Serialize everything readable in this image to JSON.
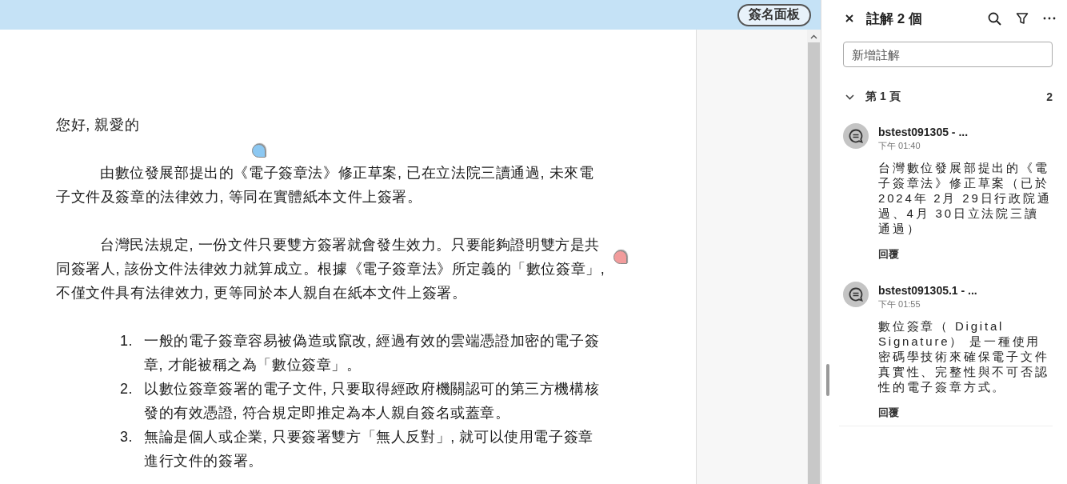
{
  "toolbar": {
    "button": "簽名面板"
  },
  "document": {
    "paragraphs": [
      {
        "kind": "plain",
        "text": "您好, 親愛的"
      },
      {
        "kind": "indented",
        "text": "由數位發展部提出的《電子簽章法》修正草案, 已在立法院三讀通過, 未來電子文件及簽章的法律效力, 等同在實體紙本文件上簽署。"
      },
      {
        "kind": "indented",
        "text": "台灣民法規定, 一份文件只要雙方簽署就會發生效力。只要能夠證明雙方是共同簽署人, 該份文件法律效力就算成立。根據《電子簽章法》所定義的「數位簽章」, 不僅文件具有法律效力, 更等同於本人親自在紙本文件上簽署。"
      }
    ],
    "list": [
      {
        "number": "1.",
        "text": "一般的電子簽章容易被偽造或竄改, 經過有效的雲端憑證加密的電子簽章, 才能被稱之為「數位簽章」。"
      },
      {
        "number": "2.",
        "text": "以數位簽章簽署的電子文件, 只要取得經政府機關認可的第三方機構核發的有效憑證, 符合規定即推定為本人親自簽名或蓋章。"
      },
      {
        "number": "3.",
        "text": "無論是個人或企業, 只要簽署雙方「無人反對」, 就可以使用電子簽章進行文件的簽署。"
      }
    ],
    "markers": [
      {
        "color": "#8cc8f2"
      },
      {
        "color": "#f29c9c"
      }
    ]
  },
  "panel": {
    "title": "註解 2 個",
    "search": {
      "placeholder": "新增註解"
    },
    "group": {
      "label": "第 1 頁",
      "count": "2",
      "expanded": true
    },
    "comments": [
      {
        "author": "bstest091305 - ...",
        "time": "下午 01:40",
        "body": "台灣數位發展部提出的《電子簽章法》修正草案（已於2024年 2月 29日行政院通過、4月 30日立法院三讀通過）",
        "reply": "回覆"
      },
      {
        "author": "bstest091305.1 - ...",
        "time": "下午 01:55",
        "body": "數位簽章（ Digital Signature） 是一種使用密碼學技術來確保電子文件真實性、完整性與不可否認性的電子簽章方式。",
        "reply": "回覆"
      }
    ]
  }
}
